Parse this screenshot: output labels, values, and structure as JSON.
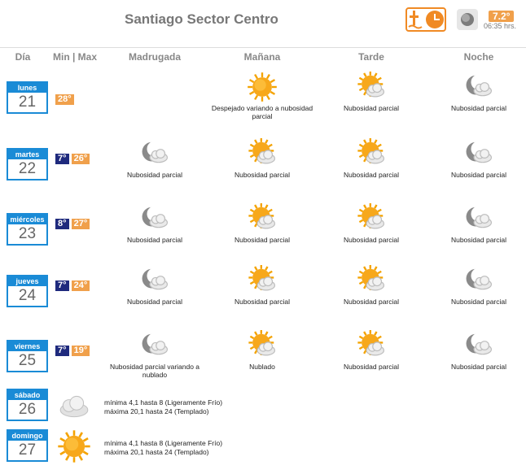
{
  "header": {
    "title": "Santiago Sector Centro",
    "temp": "7.2°",
    "time": "06:35 hrs."
  },
  "columns": [
    "Día",
    "Min | Max",
    "Madrugada",
    "Mañana",
    "Tarde",
    "Noche"
  ],
  "days": [
    {
      "name": "lunes",
      "num": "21",
      "min": "",
      "max": "28°",
      "madrugada": null,
      "manana": {
        "icon": "sun-icon",
        "text": "Despejado variando a nubosidad parcial"
      },
      "tarde": {
        "icon": "sun-cloud-icon",
        "text": "Nubosidad parcial"
      },
      "noche": {
        "icon": "moon-cloud-icon",
        "text": "Nubosidad parcial"
      }
    },
    {
      "name": "martes",
      "num": "22",
      "min": "7°",
      "max": "26°",
      "madrugada": {
        "icon": "moon-cloud-icon",
        "text": "Nubosidad parcial"
      },
      "manana": {
        "icon": "sun-cloud-icon",
        "text": "Nubosidad parcial"
      },
      "tarde": {
        "icon": "sun-cloud-icon",
        "text": "Nubosidad parcial"
      },
      "noche": {
        "icon": "moon-cloud-icon",
        "text": "Nubosidad parcial"
      }
    },
    {
      "name": "miércoles",
      "num": "23",
      "min": "8°",
      "max": "27°",
      "madrugada": {
        "icon": "moon-cloud-icon",
        "text": "Nubosidad parcial"
      },
      "manana": {
        "icon": "sun-cloud-icon",
        "text": "Nubosidad parcial"
      },
      "tarde": {
        "icon": "sun-cloud-icon",
        "text": "Nubosidad parcial"
      },
      "noche": {
        "icon": "moon-cloud-icon",
        "text": "Nubosidad parcial"
      }
    },
    {
      "name": "jueves",
      "num": "24",
      "min": "7°",
      "max": "24°",
      "madrugada": {
        "icon": "moon-cloud-icon",
        "text": "Nubosidad parcial"
      },
      "manana": {
        "icon": "sun-cloud-icon",
        "text": "Nubosidad parcial"
      },
      "tarde": {
        "icon": "sun-cloud-icon",
        "text": "Nubosidad parcial"
      },
      "noche": {
        "icon": "moon-cloud-icon",
        "text": "Nubosidad parcial"
      }
    },
    {
      "name": "viernes",
      "num": "25",
      "min": "7°",
      "max": "19°",
      "madrugada": {
        "icon": "moon-cloud-icon",
        "text": "Nubosidad parcial variando a nublado"
      },
      "manana": {
        "icon": "sun-cloud-icon",
        "text": "Nublado"
      },
      "tarde": {
        "icon": "sun-cloud-icon",
        "text": "Nubosidad parcial"
      },
      "noche": {
        "icon": "moon-cloud-icon",
        "text": "Nubosidad parcial"
      }
    }
  ],
  "extended": [
    {
      "name": "sábado",
      "num": "26",
      "icon": "cloud-icon",
      "line1": "mínima 4,1 hasta 8 (Ligeramente Frío)",
      "line2": "máxima 20,1 hasta 24 (Templado)"
    },
    {
      "name": "domingo",
      "num": "27",
      "icon": "sun-icon",
      "line1": "mínima 4,1 hasta 8 (Ligeramente Frío)",
      "line2": "máxima 20,1 hasta 24 (Templado)"
    }
  ],
  "colors": {
    "accent": "#1a8bd6",
    "min": "#1f2a7d",
    "max": "#f0a04b"
  }
}
